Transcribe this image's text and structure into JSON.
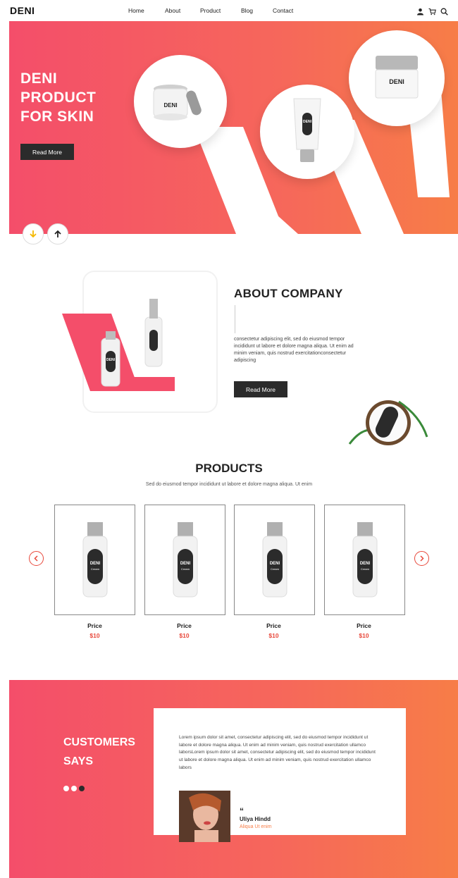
{
  "header": {
    "logo": "DENI",
    "nav": [
      "Home",
      "About",
      "Product",
      "Blog",
      "Contact"
    ],
    "icons": [
      "user-icon",
      "cart-icon",
      "search-icon"
    ]
  },
  "hero": {
    "title": "DENI\nPRODUCT\nFOR SKIN",
    "button": "Read More",
    "product_labels": [
      "DENI",
      "DENI",
      "DENI"
    ]
  },
  "about": {
    "title": "ABOUT COMPANY",
    "text": "consectetur adipiscing elit, sed do eiusmod tempor incididunt ut labore et dolore magna aliqua. Ut enim ad minim veniam, quis nostrud exercitationconsectetur adipiscing",
    "button": "Read More",
    "bottle_label": "DENI"
  },
  "products": {
    "title": "PRODUCTS",
    "subtitle": "Sed do eiusmod tempor incididunt ut labore et dolore magna aliqua. Ut enim",
    "items": [
      {
        "label": "DENI",
        "sub": "Cream",
        "price_label": "Price",
        "price": "$10"
      },
      {
        "label": "DENI",
        "sub": "Cream",
        "price_label": "Price",
        "price": "$10"
      },
      {
        "label": "DENI",
        "sub": "Cream",
        "price_label": "Price",
        "price": "$10"
      },
      {
        "label": "DENI",
        "sub": "Cream",
        "price_label": "Price",
        "price": "$10"
      }
    ]
  },
  "testimonials": {
    "title": "CUSTOMERS\nSAYS",
    "text": "Lorem ipsum dolor sit amet, consectetur adipiscing elit, sed do eiusmod tempor incididunt ut labore et dolore magna aliqua. Ut enim ad minim veniam, quis nostrud exercitation ullamco laborsLorem ipsum dolor sit amet, consectetur adipiscing elit, sed do eiusmod tempor incididunt ut labore et dolore magna aliqua. Ut enim ad minim veniam, quis nostrud exercitation ullamco labors",
    "quote_mark": "“",
    "name": "Uliya Hindd",
    "role": "Aliqua Ut enim"
  },
  "colors": {
    "gradient_start": "#f44e6a",
    "gradient_end": "#f77d47",
    "dark": "#2b2b2b",
    "price": "#e8483b"
  }
}
